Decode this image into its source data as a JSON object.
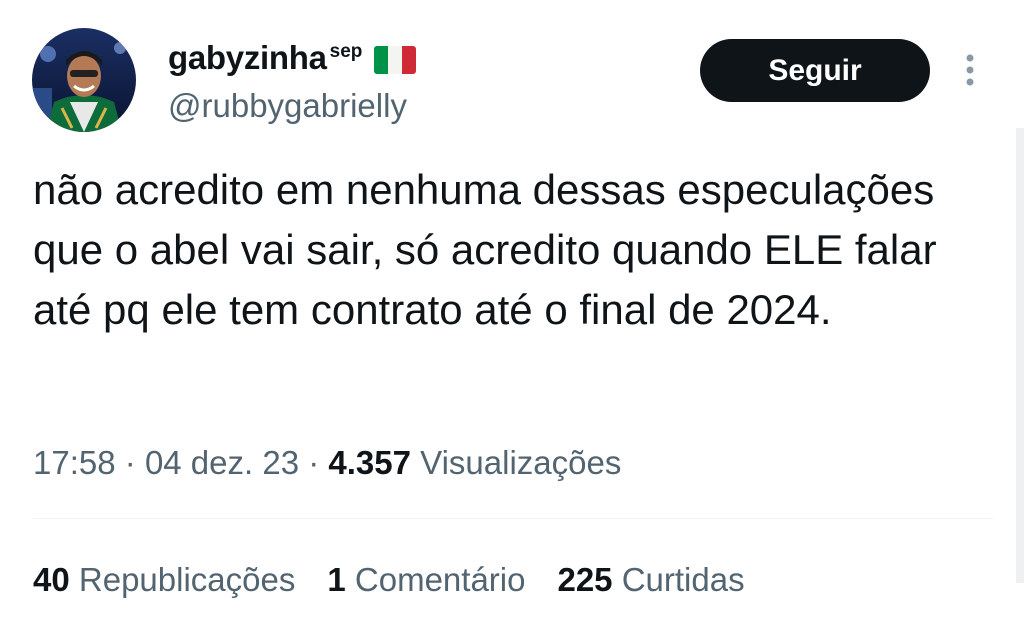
{
  "author": {
    "display_name": "gabyzinha",
    "display_name_superscript": "sep",
    "flag_icon": "italy-flag-icon",
    "flag_colors": [
      "#009246",
      "#ffffff",
      "#ce2b37"
    ],
    "handle": "@rubbygabrielly",
    "avatar_icon": "profile-photo"
  },
  "follow_button": {
    "label": "Seguir",
    "background": "#0f1419",
    "text_color": "#ffffff"
  },
  "more_menu_icon": "vertical-ellipsis-icon",
  "tweet": {
    "text": "não acredito em nenhuma dessas especulações que o abel vai sair, só acredito quando ELE falar até pq ele tem contrato até o final de 2024.",
    "time": "17:58",
    "separator": "·",
    "date": "04 dez. 23",
    "views_count": "4.357",
    "views_label": "Visualizações"
  },
  "stats": {
    "reposts": {
      "count": "40",
      "label": "Republicações"
    },
    "comments": {
      "count": "1",
      "label": "Comentário"
    },
    "likes": {
      "count": "225",
      "label": "Curtidas"
    }
  },
  "colors": {
    "primary_text": "#0f1419",
    "secondary_text": "#536471",
    "divider": "#eff3f4"
  }
}
